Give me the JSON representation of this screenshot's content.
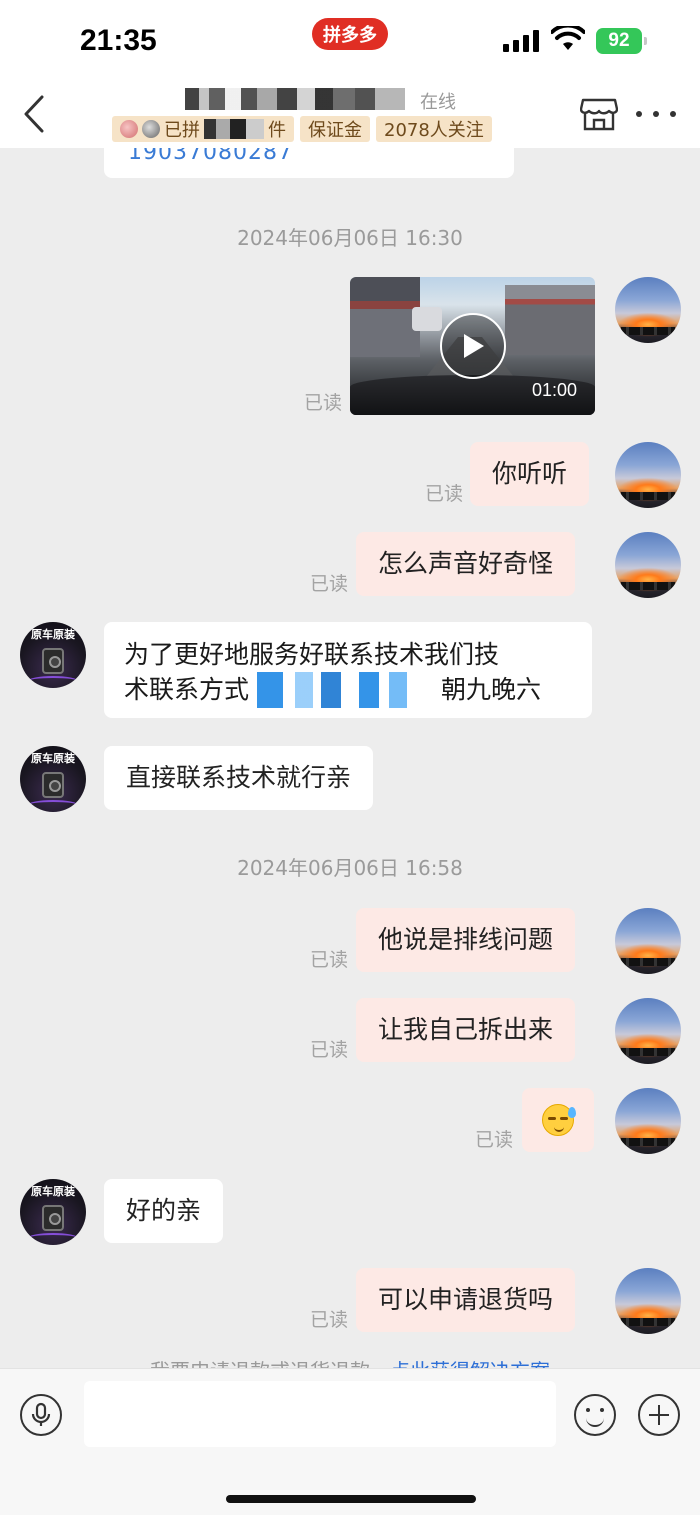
{
  "status_bar": {
    "time": "21:35",
    "app_pill": "拼多多",
    "battery": "92"
  },
  "header": {
    "online_status": "在线",
    "tags": [
      "已拼",
      "件",
      "保证金",
      "2078人关注"
    ]
  },
  "chat": {
    "card_snippet_number": "19037080287",
    "timestamp_1": "2024年06月06日 16:30",
    "timestamp_2": "2024年06月06日 16:58",
    "video_duration": "01:00",
    "read_label": "已读",
    "messages": [
      {
        "text": "你听听"
      },
      {
        "text": "怎么声音好奇怪"
      },
      {
        "line1": "为了更好地服务好联系技术我们技",
        "line2_prefix": "术联系方式",
        "line2_suffix": "朝九晚六"
      },
      {
        "text": "直接联系技术就行亲"
      },
      {
        "text": "他说是排线问题"
      },
      {
        "text": "让我自己拆出来"
      },
      {
        "text": "好的亲"
      },
      {
        "text": "可以申请退货吗"
      }
    ],
    "shop_avatar_label": "原车原装",
    "refund_hint_text": "我要申请退款或退货退款，",
    "refund_hint_link": "点此获得解决方案"
  },
  "input_bar": {
    "placeholder": ""
  }
}
